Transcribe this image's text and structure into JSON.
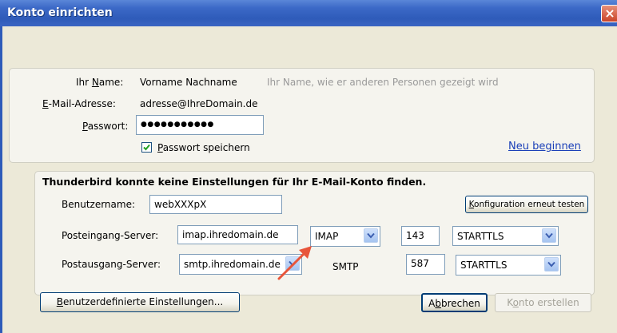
{
  "window": {
    "title": "Konto einrichten",
    "close_symbol": "×"
  },
  "identity": {
    "name_label_prefix": "Ihr ",
    "name_label_accel": "N",
    "name_label_suffix": "ame:",
    "name_value": "Vorname Nachname",
    "name_hint": "Ihr Name, wie er anderen Personen gezeigt wird",
    "email_label_accel": "E",
    "email_label_suffix": "-Mail-Adresse:",
    "email_value": "adresse@IhreDomain.de",
    "password_label_accel": "P",
    "password_label_suffix": "asswort:",
    "password_value": "●●●●●●●●●●●",
    "remember_accel": "P",
    "remember_suffix": "asswort speichern",
    "remember_checked": true,
    "restart_link": "Neu beginnen"
  },
  "server": {
    "heading": "Thunderbird konnte keine Einstellungen für Ihr E-Mail-Konto finden.",
    "username_label": "Benutzername:",
    "username_value": "webXXXpX",
    "retest_accel": "K",
    "retest_suffix": "onfiguration erneut testen",
    "incoming_label": "Posteingang-Server:",
    "incoming_host": "imap.ihredomain.de",
    "incoming_protocol": "IMAP",
    "incoming_port": "143",
    "incoming_security": "STARTTLS",
    "outgoing_label": "Postausgang-Server:",
    "outgoing_host": "smtp.ihredomain.de",
    "outgoing_protocol": "SMTP",
    "outgoing_port": "587",
    "outgoing_security": "STARTTLS"
  },
  "footer": {
    "advanced_accel": "B",
    "advanced_suffix": "enutzerdefinierte Einstellungen...",
    "cancel_prefix": "A",
    "cancel_accel": "b",
    "cancel_suffix": "brechen",
    "create_prefix": "K",
    "create_accel": "o",
    "create_suffix": "nto erstellen"
  },
  "colors": {
    "title_bar": "#2e5bb9",
    "annotation_arrow": "#e8553a",
    "link": "#1a3fb8"
  }
}
